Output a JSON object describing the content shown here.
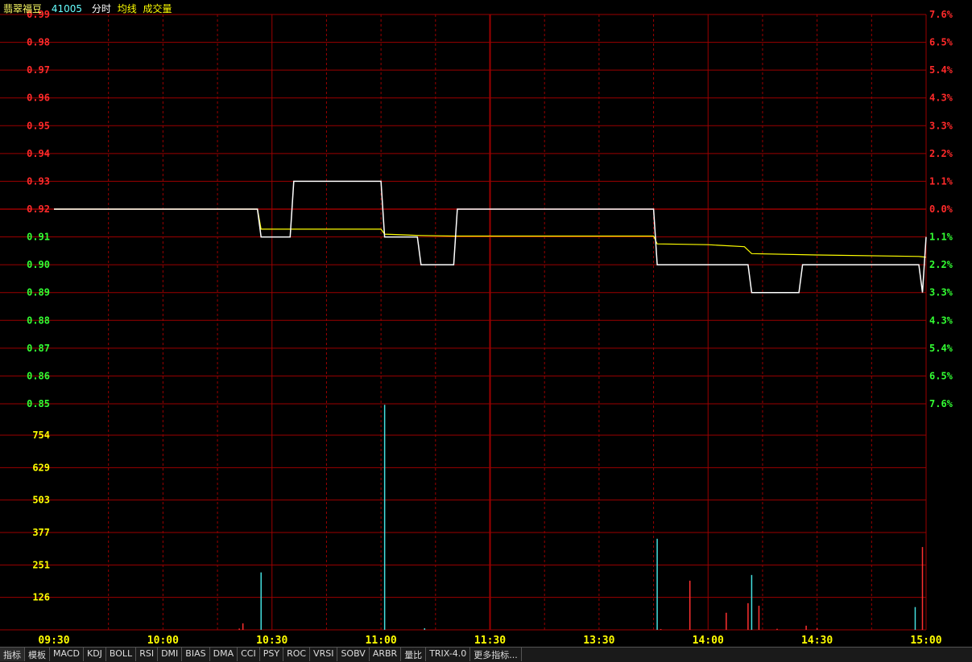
{
  "header": {
    "stock_name": "翡翠福豆",
    "stock_code": "41005",
    "mode_label": "分时",
    "avg_label": "均线",
    "volume_label": "成交量"
  },
  "colors": {
    "background": "#000000",
    "grid": "#9b0000",
    "up": "#ff2a2a",
    "down": "#33ff33",
    "neutral_label": "#ffff00",
    "price_line": "#ffffff",
    "avg_line": "#ffff00",
    "volume_down": "#44e0e0",
    "volume_up": "#ff3030"
  },
  "toolbar": {
    "items": [
      "指标",
      "模板",
      "MACD",
      "KDJ",
      "BOLL",
      "RSI",
      "DMI",
      "BIAS",
      "DMA",
      "CCI",
      "PSY",
      "ROC",
      "VRSI",
      "SOBV",
      "ARBR",
      "量比",
      "TRIX-4.0",
      "更多指标..."
    ]
  },
  "chart_data": {
    "type": "line",
    "title": "",
    "prev_close": 0.92,
    "price_axis": {
      "left_ticks": [
        "0.99",
        "0.98",
        "0.97",
        "0.96",
        "0.95",
        "0.94",
        "0.93",
        "0.92",
        "0.91",
        "0.90",
        "0.89",
        "0.88",
        "0.87",
        "0.86",
        "0.85"
      ],
      "right_ticks": [
        "7.6%",
        "6.5%",
        "5.4%",
        "4.3%",
        "3.3%",
        "2.2%",
        "1.1%",
        "0.0%",
        "1.1%",
        "2.2%",
        "3.3%",
        "4.3%",
        "5.4%",
        "6.5%",
        "7.6%"
      ],
      "ylim": [
        0.85,
        0.99
      ]
    },
    "volume_axis": {
      "ticks": [
        "754",
        "629",
        "503",
        "377",
        "251",
        "126"
      ],
      "ylim": [
        0,
        880
      ]
    },
    "time_ticks": [
      "09:30",
      "10:00",
      "10:30",
      "11:00",
      "11:30",
      "13:30",
      "14:00",
      "14:30",
      "15:00"
    ],
    "price_series": {
      "name": "分时",
      "points": [
        [
          0,
          0.92
        ],
        [
          56,
          0.92
        ],
        [
          57,
          0.91
        ],
        [
          65,
          0.91
        ],
        [
          66,
          0.93
        ],
        [
          90,
          0.93
        ],
        [
          91,
          0.91
        ],
        [
          100,
          0.91
        ],
        [
          101,
          0.9
        ],
        [
          110,
          0.9
        ],
        [
          111,
          0.92
        ],
        [
          165,
          0.92
        ],
        [
          166,
          0.9
        ],
        [
          191,
          0.9
        ],
        [
          192,
          0.89
        ],
        [
          205,
          0.89
        ],
        [
          206,
          0.9
        ],
        [
          238,
          0.9
        ],
        [
          239,
          0.89
        ],
        [
          240,
          0.91
        ]
      ]
    },
    "avg_series": {
      "name": "均线",
      "points": [
        [
          0,
          0.92
        ],
        [
          56,
          0.92
        ],
        [
          57,
          0.9128
        ],
        [
          90,
          0.9128
        ],
        [
          91,
          0.911
        ],
        [
          101,
          0.9105
        ],
        [
          110,
          0.9103
        ],
        [
          165,
          0.9103
        ],
        [
          166,
          0.9075
        ],
        [
          180,
          0.9072
        ],
        [
          190,
          0.9065
        ],
        [
          192,
          0.904
        ],
        [
          210,
          0.9035
        ],
        [
          238,
          0.903
        ],
        [
          240,
          0.9027
        ]
      ]
    },
    "volume_series": {
      "name": "成交量",
      "bars": [
        [
          51,
          5,
          "up"
        ],
        [
          52,
          25,
          "up"
        ],
        [
          57,
          222,
          "down"
        ],
        [
          91,
          870,
          "down"
        ],
        [
          102,
          6,
          "down"
        ],
        [
          166,
          352,
          "down"
        ],
        [
          167,
          3,
          "up"
        ],
        [
          175,
          190,
          "up"
        ],
        [
          185,
          66,
          "up"
        ],
        [
          191,
          103,
          "up"
        ],
        [
          192,
          212,
          "down"
        ],
        [
          194,
          93,
          "up"
        ],
        [
          199,
          4,
          "up"
        ],
        [
          207,
          16,
          "up"
        ],
        [
          210,
          6,
          "up"
        ],
        [
          237,
          88,
          "down"
        ],
        [
          239,
          320,
          "up"
        ]
      ]
    }
  }
}
